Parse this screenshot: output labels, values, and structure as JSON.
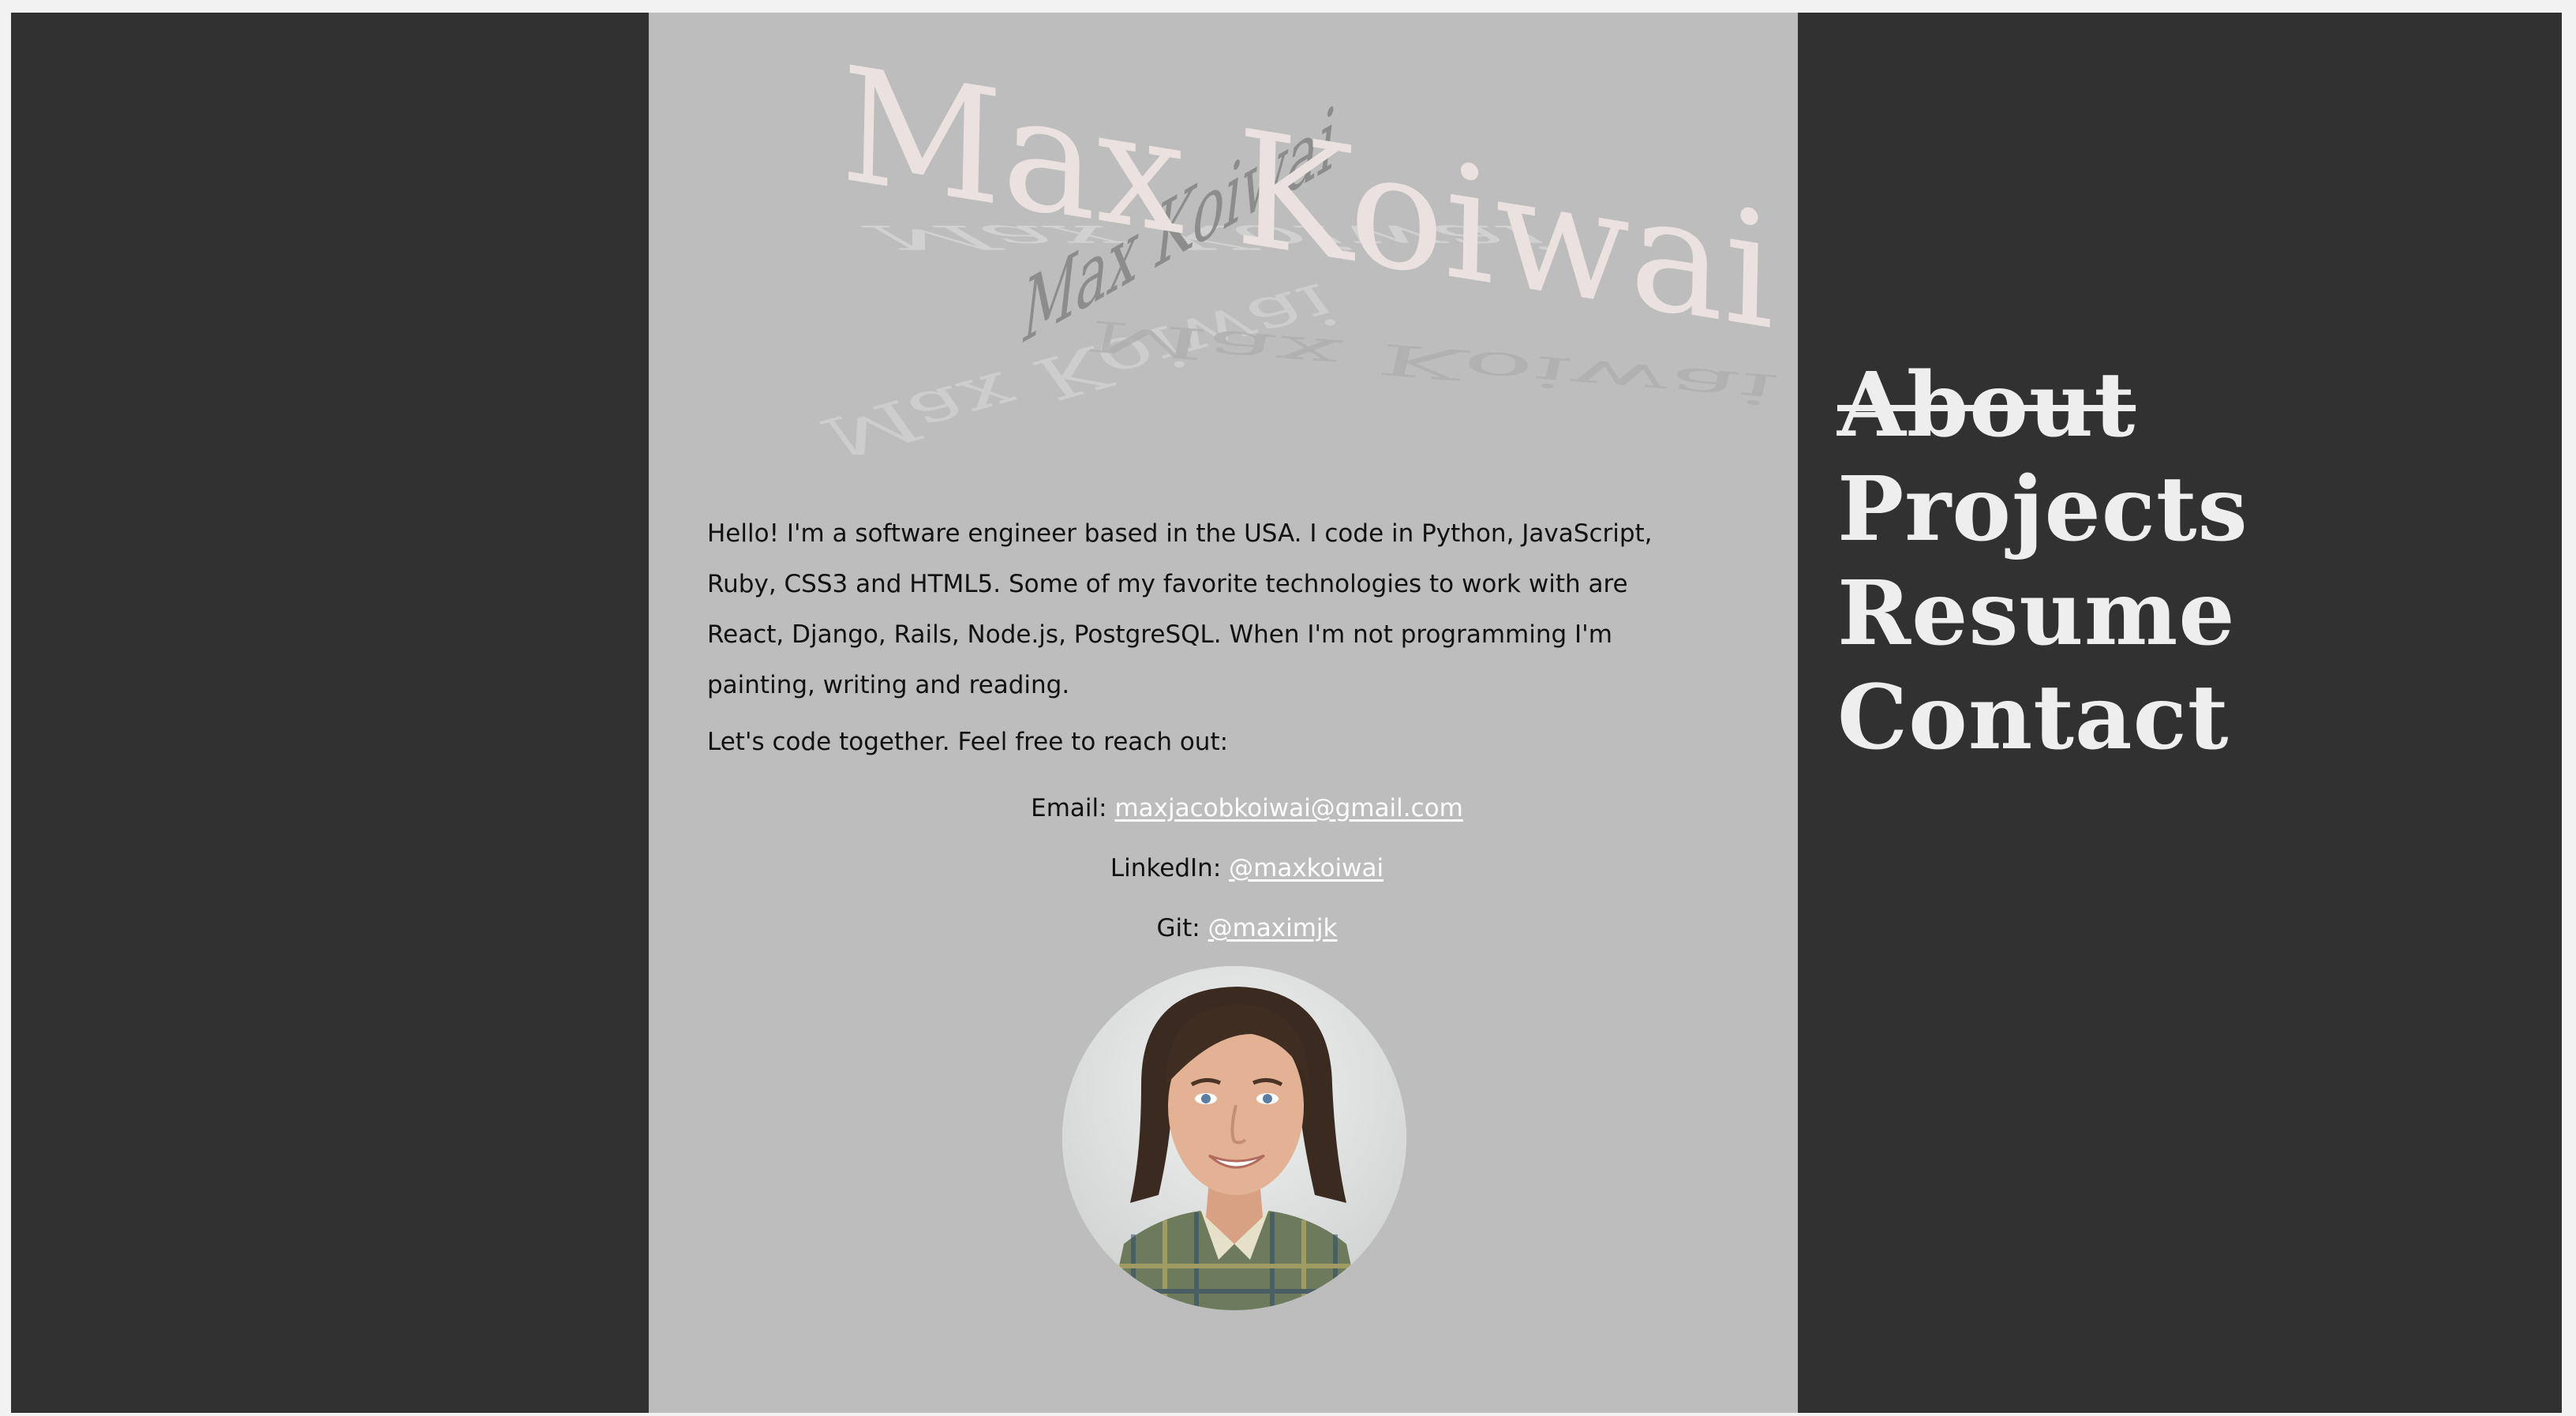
{
  "site": {
    "logo_text": "Max Koiwai"
  },
  "nav": {
    "items": [
      {
        "label": "About",
        "active": true
      },
      {
        "label": "Projects",
        "active": false
      },
      {
        "label": "Resume",
        "active": false
      },
      {
        "label": "Contact",
        "active": false
      }
    ]
  },
  "about": {
    "intro": "Hello! I'm a software engineer based in the USA. I code in Python, JavaScript, Ruby, CSS3 and HTML5. Some of my favorite technologies to work with are React, Django, Rails, Node.js, PostgreSQL. When I'm not programming I'm painting, writing and reading.",
    "cta": "Let's code together. Feel free to reach out:",
    "contacts": {
      "email": {
        "label": "Email:",
        "value": "maxjacobkoiwai@gmail.com"
      },
      "linkedin": {
        "label": "LinkedIn:",
        "value": "@maxkoiwai"
      },
      "git": {
        "label": "Git:",
        "value": "@maximjk"
      }
    },
    "avatar_icon": "profile-photo"
  },
  "colors": {
    "background": "#313131",
    "content_panel": "#bdbdbd",
    "link": "#ffffff",
    "nav_text": "#eeeeee",
    "logo": "#ebe1e1"
  }
}
